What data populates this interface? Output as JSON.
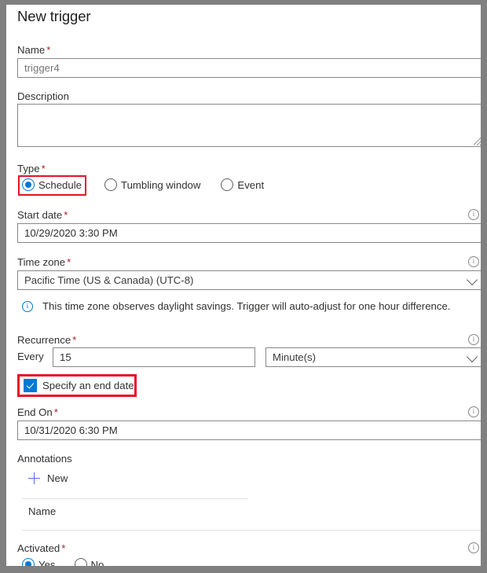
{
  "panel": {
    "title": "New trigger"
  },
  "fields": {
    "name": {
      "label": "Name",
      "required": "*",
      "value": "trigger4"
    },
    "description": {
      "label": "Description",
      "value": ""
    },
    "type": {
      "label": "Type",
      "required": "*",
      "options": [
        {
          "label": "Schedule",
          "selected": true
        },
        {
          "label": "Tumbling window",
          "selected": false
        },
        {
          "label": "Event",
          "selected": false
        }
      ]
    },
    "start_date": {
      "label": "Start date",
      "required": "*",
      "value": "10/29/2020 3:30 PM",
      "info_icon": "info-icon"
    },
    "time_zone": {
      "label": "Time zone",
      "required": "*",
      "value": "Pacific Time (US & Canada) (UTC-8)",
      "info_icon": "info-icon",
      "chevron": "chevron-down-icon",
      "message": "This time zone observes daylight savings. Trigger will auto-adjust for one hour difference.",
      "message_icon": "info-icon"
    },
    "recurrence": {
      "label": "Recurrence",
      "required": "*",
      "info_icon": "info-icon",
      "every_label": "Every",
      "interval_value": "15",
      "unit_value": "Minute(s)",
      "unit_chevron": "chevron-down-icon"
    },
    "specify_end_date": {
      "label": "Specify an end date",
      "checked": true
    },
    "end_on": {
      "label": "End On",
      "required": "*",
      "value": "10/31/2020 6:30 PM",
      "info_icon": "info-icon"
    },
    "annotations": {
      "label": "Annotations",
      "new_button": "New",
      "new_icon": "plus-icon",
      "column_header": "Name"
    },
    "activated": {
      "label": "Activated",
      "required": "*",
      "info_icon": "info-icon",
      "options": [
        {
          "label": "Yes",
          "selected": true
        },
        {
          "label": "No",
          "selected": false
        }
      ]
    }
  },
  "colors": {
    "accent": "#0078d4",
    "highlight": "#e81123",
    "required": "#a4262c",
    "border": "#8a8886",
    "window_chrome": "#808080"
  }
}
